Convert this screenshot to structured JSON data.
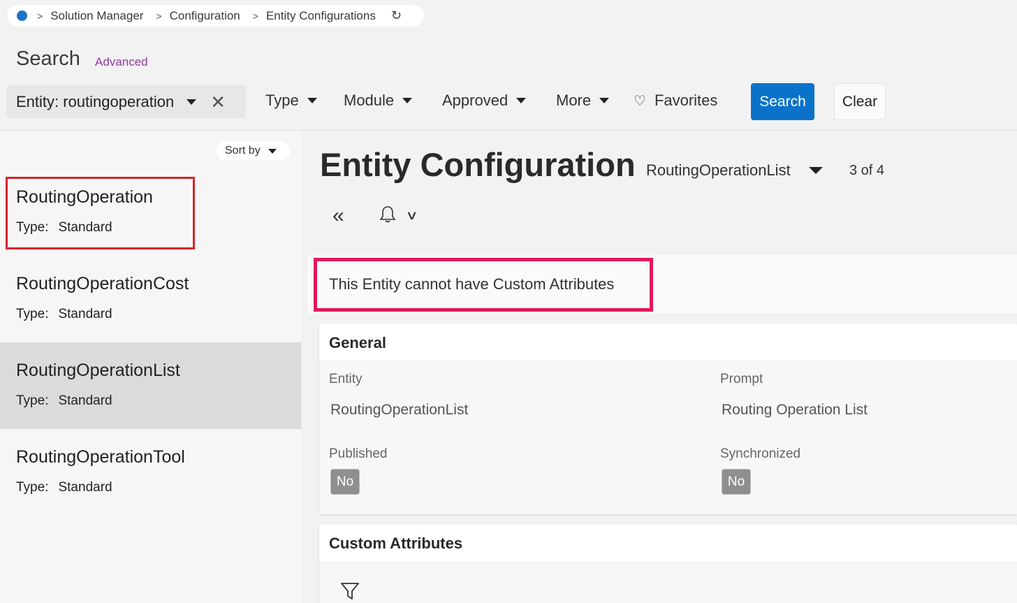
{
  "breadcrumb": {
    "items": [
      "Solution Manager",
      "Configuration",
      "Entity Configurations"
    ],
    "separator": ">",
    "refresh_icon": "refresh-icon"
  },
  "search": {
    "title": "Search",
    "advanced_label": "Advanced"
  },
  "filters": {
    "entity_chip": "Entity: routingoperation",
    "type": "Type",
    "module": "Module",
    "approved": "Approved",
    "more": "More",
    "favorites": "Favorites",
    "search_button": "Search",
    "clear_button": "Clear"
  },
  "list": {
    "sort_label": "Sort by",
    "type_label": "Type:",
    "items": [
      {
        "name": "RoutingOperation",
        "type": "Standard"
      },
      {
        "name": "RoutingOperationCost",
        "type": "Standard"
      },
      {
        "name": "RoutingOperationList",
        "type": "Standard"
      },
      {
        "name": "RoutingOperationTool",
        "type": "Standard"
      }
    ],
    "selected_index": 2,
    "highlighted_index": 0
  },
  "detail": {
    "heading": "Entity Configuration",
    "record": "RoutingOperationList",
    "page_count": "3 of 4",
    "notice": "This Entity cannot have Custom Attributes",
    "general": {
      "title": "General",
      "entity_label": "Entity",
      "entity_value": "RoutingOperationList",
      "prompt_label": "Prompt",
      "prompt_value": "Routing Operation List",
      "published_label": "Published",
      "published_value": "No",
      "synchronized_label": "Synchronized",
      "synchronized_value": "No"
    },
    "custom_attributes": {
      "title": "Custom Attributes"
    }
  },
  "colors": {
    "primary": "#0a73c9",
    "highlight_red": "#d6232b",
    "notice_border": "#e0195c",
    "advanced_link": "#8a3b98",
    "badge": "#8f8f8f"
  }
}
